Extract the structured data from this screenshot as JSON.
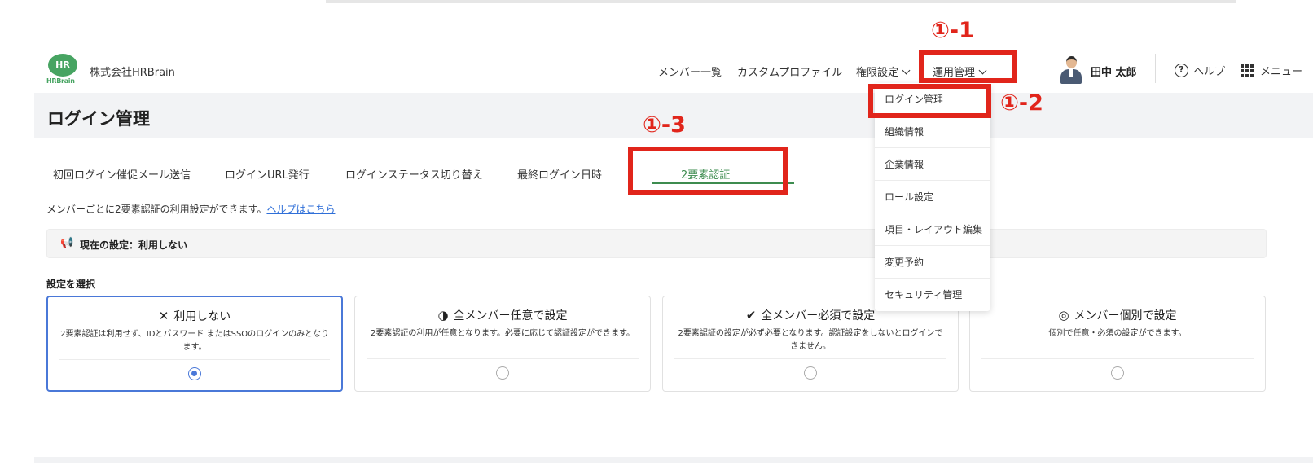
{
  "header": {
    "logo_text_top": "HR",
    "logo_text_bottom": "HRBrain",
    "company": "株式会社HRBrain",
    "nav": {
      "members": "メンバー一覧",
      "custom_profile": "カスタムプロファイル",
      "permissions": "権限設定",
      "operations": "運用管理"
    },
    "user_name": "田中 太郎",
    "help": "ヘルプ",
    "menu": "メニュー"
  },
  "page": {
    "title": "ログイン管理"
  },
  "tabs": [
    {
      "label": "初回ログイン催促メール送信"
    },
    {
      "label": "ログインURL発行"
    },
    {
      "label": "ログインステータス切り替え"
    },
    {
      "label": "最終ログイン日時"
    },
    {
      "label": "2要素認証"
    }
  ],
  "description": {
    "text": "メンバーごとに2要素認証の利用設定ができます。",
    "link": "ヘルプはこちら"
  },
  "current_setting": "現在の設定：利用しない",
  "select_label": "設定を選択",
  "cards": [
    {
      "icon": "✕",
      "title": "利用しない",
      "desc": "2要素認証は利用せず、IDとパスワード またはSSOのログインのみとなります。",
      "selected": true
    },
    {
      "icon": "◑",
      "title": "全メンバー任意で設定",
      "desc": "2要素認証の利用が任意となります。必要に応じて認証設定ができます。",
      "selected": false
    },
    {
      "icon": "✔",
      "title": "全メンバー必須で設定",
      "desc": "2要素認証の設定が必ず必要となります。認証設定をしないとログインできません。",
      "selected": false
    },
    {
      "icon": "◎",
      "title": "メンバー個別で設定",
      "desc": "個別で任意・必須の設定ができます。",
      "selected": false
    }
  ],
  "dropdown": {
    "items": [
      {
        "label": "ログイン管理"
      },
      {
        "label": "組織情報"
      },
      {
        "label": "企業情報"
      },
      {
        "label": "ロール設定"
      },
      {
        "label": "項目・レイアウト編集"
      },
      {
        "label": "変更予約"
      },
      {
        "label": "セキュリティ管理"
      }
    ]
  },
  "annotations": {
    "step1": "①-1",
    "step2": "①-2",
    "step3": "①-3",
    "color": "#e1251b"
  },
  "colors": {
    "accent_green": "#3d8c4f",
    "selected_blue": "#4a78d8",
    "brand_green": "#47a462"
  }
}
